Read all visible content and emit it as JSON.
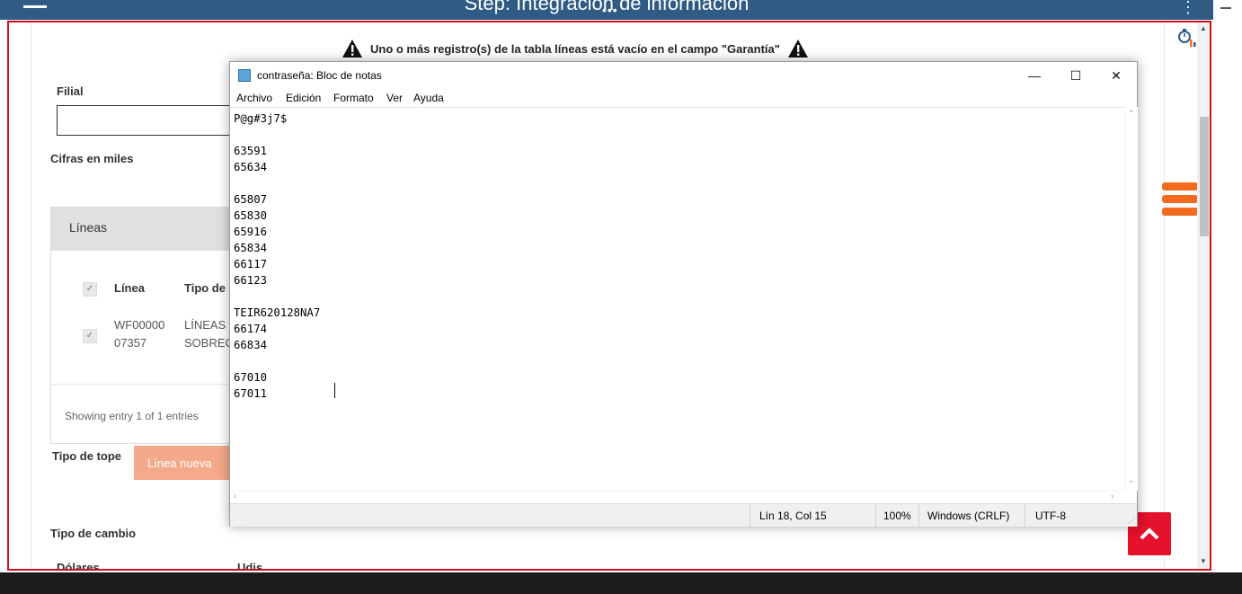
{
  "topbar": {
    "title": "Step: Integración de información",
    "dots": "•••"
  },
  "warning": {
    "text": "Uno o más registro(s) de la tabla líneas está vacío en el campo \"Garantía\""
  },
  "form": {
    "filial_label": "Filial",
    "cifras_label": "Cifras en miles",
    "tipo_tope_label": "Tipo de tope",
    "linea_nueva_button": "Línea nueva",
    "tipo_cambio_label": "Tipo de cambio",
    "dolares_label": "Dólares",
    "udis_label": "Udis"
  },
  "lineas_panel": {
    "header": "Líneas",
    "columns": [
      "Línea",
      "Tipo de"
    ],
    "row": {
      "linea_line1": "WF00000",
      "linea_line2": "07357",
      "tipo_line1": "LÍNEAS",
      "tipo_line2": "SOBREC"
    },
    "showing": "Showing entry 1 of 1 entries"
  },
  "notepad": {
    "title": "contraseña: Bloc de notas",
    "menu": [
      "Archivo",
      "Edición",
      "Formato",
      "Ver",
      "Ayuda"
    ],
    "content": "P@g#3j7$\n\n63591\n65634\n\n65807\n65830\n65916\n65834\n66117\n66123\n\nTEIR620128NA7\n66174\n66834\n\n67010\n67011",
    "status": {
      "position": "Lín 18, Col 15",
      "zoom": "100%",
      "line_ending": "Windows (CRLF)",
      "encoding": "UTF-8"
    },
    "window_buttons": {
      "minimize": "—",
      "maximize": "☐",
      "close": "✕"
    }
  },
  "colors": {
    "topbar": "#2f5b84",
    "frame_border": "#d0101b",
    "orange_menu": "#f26b21",
    "scroll_top_button": "#e5122c",
    "linea_nueva_button": "#f4a98a"
  }
}
